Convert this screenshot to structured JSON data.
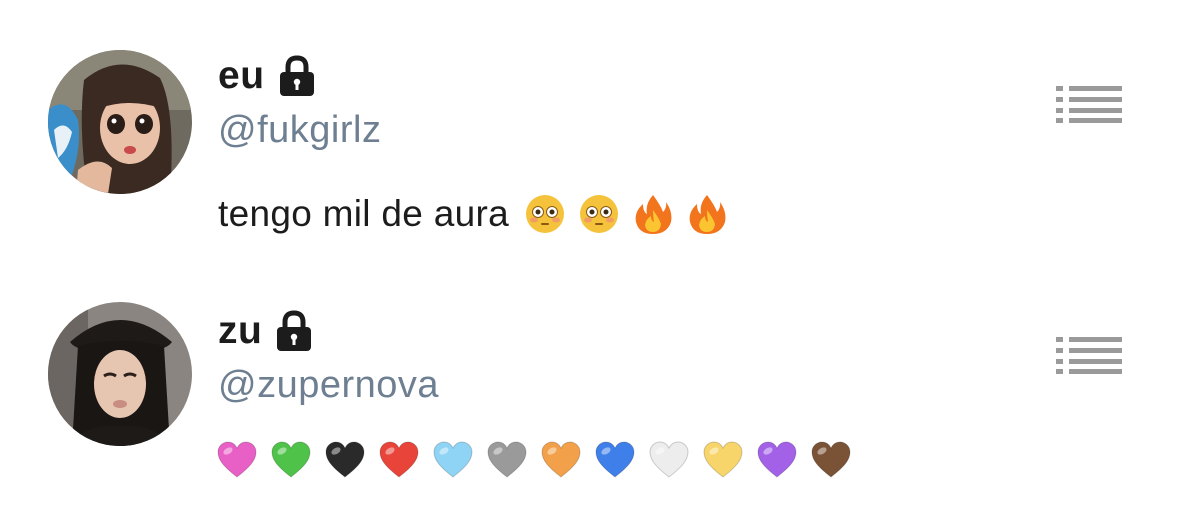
{
  "posts": [
    {
      "display_name": "eu",
      "handle": "@fukgirlz",
      "text": "tengo mil de aura",
      "emoji": [
        {
          "icon": "flushed-face-icon"
        },
        {
          "icon": "flushed-face-icon"
        },
        {
          "icon": "fire-icon"
        },
        {
          "icon": "fire-icon"
        }
      ]
    },
    {
      "display_name": "zu",
      "handle": "@zupernova",
      "hearts": [
        {
          "icon": "pink-heart-icon",
          "color": "#e85fc6"
        },
        {
          "icon": "green-heart-icon",
          "color": "#4fc24a"
        },
        {
          "icon": "black-heart-icon",
          "color": "#2a2a2a"
        },
        {
          "icon": "red-heart-icon",
          "color": "#e8443a"
        },
        {
          "icon": "light-blue-heart-icon",
          "color": "#8fd3f5"
        },
        {
          "icon": "grey-heart-icon",
          "color": "#9a9a9a"
        },
        {
          "icon": "orange-heart-icon",
          "color": "#f2a14a"
        },
        {
          "icon": "blue-heart-icon",
          "color": "#3f7fea"
        },
        {
          "icon": "white-heart-icon",
          "color": "#ededed"
        },
        {
          "icon": "yellow-heart-icon",
          "color": "#f7d56a"
        },
        {
          "icon": "purple-heart-icon",
          "color": "#a361e8"
        },
        {
          "icon": "brown-heart-icon",
          "color": "#7a5236"
        }
      ]
    }
  ],
  "icons": {
    "lock": "lock-icon",
    "menu": "list-menu-icon"
  },
  "colors": {
    "handle": "#6e7f91",
    "menu_icon": "#9a9a9a",
    "text": "#1c1c1c"
  }
}
